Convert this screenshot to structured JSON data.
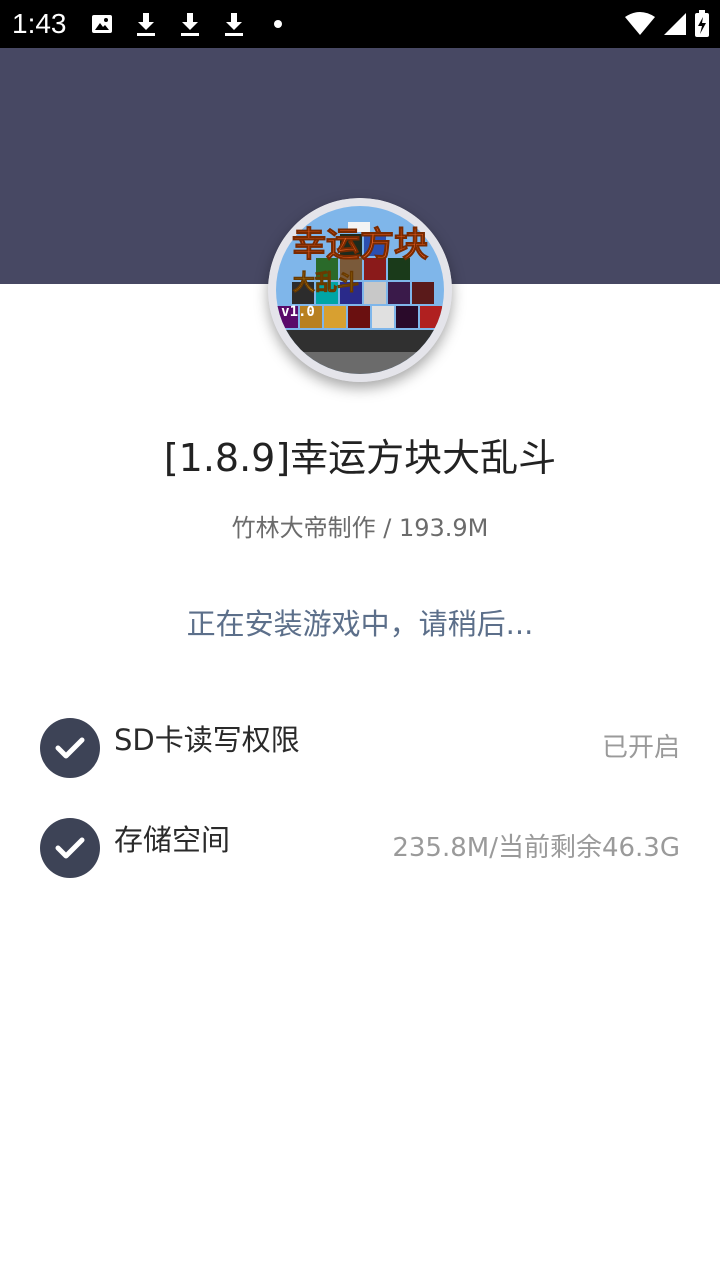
{
  "status_bar": {
    "time": "1:43",
    "left_icons": [
      "image-icon",
      "download-icon",
      "download-icon",
      "download-icon",
      "dot-icon"
    ],
    "right_icons": [
      "wifi-icon",
      "signal-icon",
      "battery-charging-icon"
    ]
  },
  "colors": {
    "header_band": "#474863",
    "check_circle": "#3d4356",
    "status_text": "#5c6f8a"
  },
  "game": {
    "icon": "game-cover-image",
    "icon_text_top": "幸运方块",
    "icon_text_mid": "大乱斗",
    "icon_text_ver": "v1.0",
    "title": "[1.8.9]幸运方块大乱斗",
    "meta": "竹林大帝制作 / 193.9M"
  },
  "install": {
    "status_text": "正在安装游戏中，请稍后..."
  },
  "permissions": [
    {
      "label": "SD卡读写权限",
      "value": "已开启",
      "icon": "check-icon"
    },
    {
      "label": "存储空间",
      "value": "235.8M/当前剩余46.3G",
      "icon": "check-icon"
    }
  ]
}
